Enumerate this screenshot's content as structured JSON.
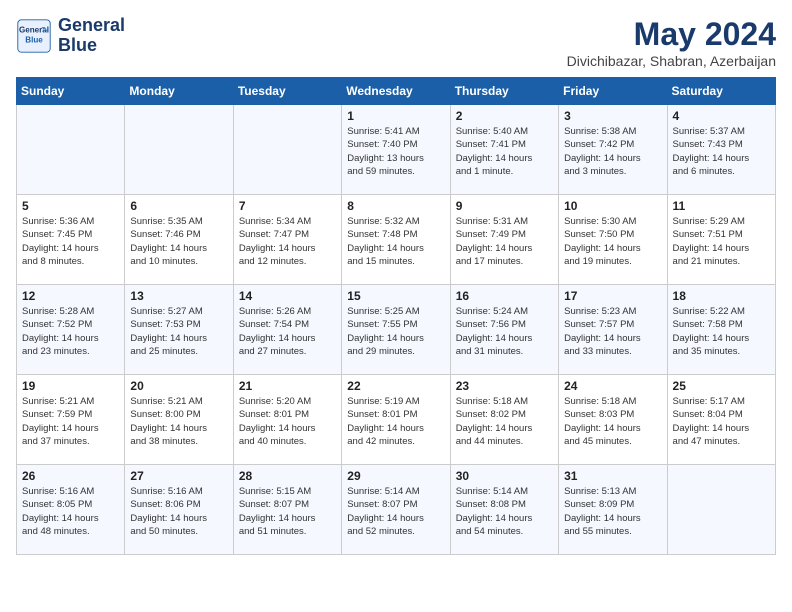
{
  "logo": {
    "text_line1": "General",
    "text_line2": "Blue"
  },
  "title": "May 2024",
  "location": "Divichibazar, Shabran, Azerbaijan",
  "days_of_week": [
    "Sunday",
    "Monday",
    "Tuesday",
    "Wednesday",
    "Thursday",
    "Friday",
    "Saturday"
  ],
  "weeks": [
    [
      {
        "day": "",
        "info": ""
      },
      {
        "day": "",
        "info": ""
      },
      {
        "day": "",
        "info": ""
      },
      {
        "day": "1",
        "info": "Sunrise: 5:41 AM\nSunset: 7:40 PM\nDaylight: 13 hours\nand 59 minutes."
      },
      {
        "day": "2",
        "info": "Sunrise: 5:40 AM\nSunset: 7:41 PM\nDaylight: 14 hours\nand 1 minute."
      },
      {
        "day": "3",
        "info": "Sunrise: 5:38 AM\nSunset: 7:42 PM\nDaylight: 14 hours\nand 3 minutes."
      },
      {
        "day": "4",
        "info": "Sunrise: 5:37 AM\nSunset: 7:43 PM\nDaylight: 14 hours\nand 6 minutes."
      }
    ],
    [
      {
        "day": "5",
        "info": "Sunrise: 5:36 AM\nSunset: 7:45 PM\nDaylight: 14 hours\nand 8 minutes."
      },
      {
        "day": "6",
        "info": "Sunrise: 5:35 AM\nSunset: 7:46 PM\nDaylight: 14 hours\nand 10 minutes."
      },
      {
        "day": "7",
        "info": "Sunrise: 5:34 AM\nSunset: 7:47 PM\nDaylight: 14 hours\nand 12 minutes."
      },
      {
        "day": "8",
        "info": "Sunrise: 5:32 AM\nSunset: 7:48 PM\nDaylight: 14 hours\nand 15 minutes."
      },
      {
        "day": "9",
        "info": "Sunrise: 5:31 AM\nSunset: 7:49 PM\nDaylight: 14 hours\nand 17 minutes."
      },
      {
        "day": "10",
        "info": "Sunrise: 5:30 AM\nSunset: 7:50 PM\nDaylight: 14 hours\nand 19 minutes."
      },
      {
        "day": "11",
        "info": "Sunrise: 5:29 AM\nSunset: 7:51 PM\nDaylight: 14 hours\nand 21 minutes."
      }
    ],
    [
      {
        "day": "12",
        "info": "Sunrise: 5:28 AM\nSunset: 7:52 PM\nDaylight: 14 hours\nand 23 minutes."
      },
      {
        "day": "13",
        "info": "Sunrise: 5:27 AM\nSunset: 7:53 PM\nDaylight: 14 hours\nand 25 minutes."
      },
      {
        "day": "14",
        "info": "Sunrise: 5:26 AM\nSunset: 7:54 PM\nDaylight: 14 hours\nand 27 minutes."
      },
      {
        "day": "15",
        "info": "Sunrise: 5:25 AM\nSunset: 7:55 PM\nDaylight: 14 hours\nand 29 minutes."
      },
      {
        "day": "16",
        "info": "Sunrise: 5:24 AM\nSunset: 7:56 PM\nDaylight: 14 hours\nand 31 minutes."
      },
      {
        "day": "17",
        "info": "Sunrise: 5:23 AM\nSunset: 7:57 PM\nDaylight: 14 hours\nand 33 minutes."
      },
      {
        "day": "18",
        "info": "Sunrise: 5:22 AM\nSunset: 7:58 PM\nDaylight: 14 hours\nand 35 minutes."
      }
    ],
    [
      {
        "day": "19",
        "info": "Sunrise: 5:21 AM\nSunset: 7:59 PM\nDaylight: 14 hours\nand 37 minutes."
      },
      {
        "day": "20",
        "info": "Sunrise: 5:21 AM\nSunset: 8:00 PM\nDaylight: 14 hours\nand 38 minutes."
      },
      {
        "day": "21",
        "info": "Sunrise: 5:20 AM\nSunset: 8:01 PM\nDaylight: 14 hours\nand 40 minutes."
      },
      {
        "day": "22",
        "info": "Sunrise: 5:19 AM\nSunset: 8:01 PM\nDaylight: 14 hours\nand 42 minutes."
      },
      {
        "day": "23",
        "info": "Sunrise: 5:18 AM\nSunset: 8:02 PM\nDaylight: 14 hours\nand 44 minutes."
      },
      {
        "day": "24",
        "info": "Sunrise: 5:18 AM\nSunset: 8:03 PM\nDaylight: 14 hours\nand 45 minutes."
      },
      {
        "day": "25",
        "info": "Sunrise: 5:17 AM\nSunset: 8:04 PM\nDaylight: 14 hours\nand 47 minutes."
      }
    ],
    [
      {
        "day": "26",
        "info": "Sunrise: 5:16 AM\nSunset: 8:05 PM\nDaylight: 14 hours\nand 48 minutes."
      },
      {
        "day": "27",
        "info": "Sunrise: 5:16 AM\nSunset: 8:06 PM\nDaylight: 14 hours\nand 50 minutes."
      },
      {
        "day": "28",
        "info": "Sunrise: 5:15 AM\nSunset: 8:07 PM\nDaylight: 14 hours\nand 51 minutes."
      },
      {
        "day": "29",
        "info": "Sunrise: 5:14 AM\nSunset: 8:07 PM\nDaylight: 14 hours\nand 52 minutes."
      },
      {
        "day": "30",
        "info": "Sunrise: 5:14 AM\nSunset: 8:08 PM\nDaylight: 14 hours\nand 54 minutes."
      },
      {
        "day": "31",
        "info": "Sunrise: 5:13 AM\nSunset: 8:09 PM\nDaylight: 14 hours\nand 55 minutes."
      },
      {
        "day": "",
        "info": ""
      }
    ]
  ]
}
